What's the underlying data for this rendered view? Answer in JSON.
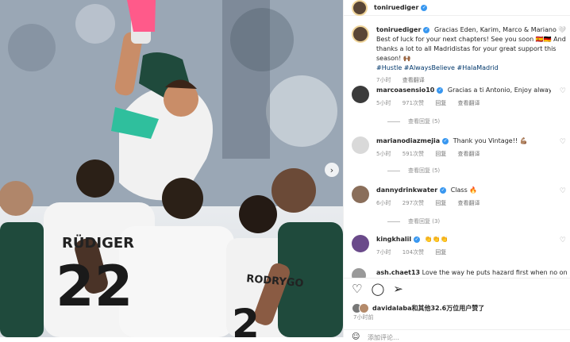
{
  "post": {
    "author": "toniruediger",
    "caption": "Gracias Eden, Karim, Marco & Mariano 🤍 Best of luck for your next chapters! See you soon 🇪🇸🇩🇪 And thanks a lot to all Madridistas for your great support this season! 🙌🏾",
    "hashtags": "#Hustle #AlwaysBelieve #HalaMadrid",
    "time": "7小时",
    "translate": "查看翻译"
  },
  "photo": {
    "jersey_name": "RÜDIGER",
    "jersey_number": "22",
    "jersey_name2": "RODRYGO",
    "next_icon": "chevron-right"
  },
  "comments": [
    {
      "user": "marcoasensio10",
      "text": "Gracias a ti Antonio, Enjoy always 😍✊🏾😘",
      "time": "5小时",
      "likes": "971次赞",
      "reply": "回复",
      "translate": "查看翻译",
      "replies": "查看回复 (5)"
    },
    {
      "user": "marianodiazmejia",
      "text": "Thank you Vintage!! 💪🏽",
      "time": "5小时",
      "likes": "591次赞",
      "reply": "回复",
      "translate": "查看翻译",
      "replies": "查看回复 (5)"
    },
    {
      "user": "dannydrinkwater",
      "text": "Class 🔥",
      "time": "6小时",
      "likes": "297次赞",
      "reply": "回复",
      "translate": "查看翻译",
      "replies": "查看回复 (3)"
    },
    {
      "user": "kingkhalil",
      "text": "👏👏👏",
      "time": "7小时",
      "likes": "104次赞",
      "reply": "回复",
      "translate": "",
      "replies": ""
    }
  ],
  "partial_comment": {
    "user": "ash.chaet13",
    "text": "Love the way he puts hazard first when no one"
  },
  "footer": {
    "likes_text": "davidalaba和其他32.6万位用户赞了",
    "date": "7小时前",
    "add_comment": "添加评论…"
  },
  "colors": {
    "link": "#00376b",
    "verified": "#3897f0",
    "madrid_green": "#1f4a3c"
  }
}
